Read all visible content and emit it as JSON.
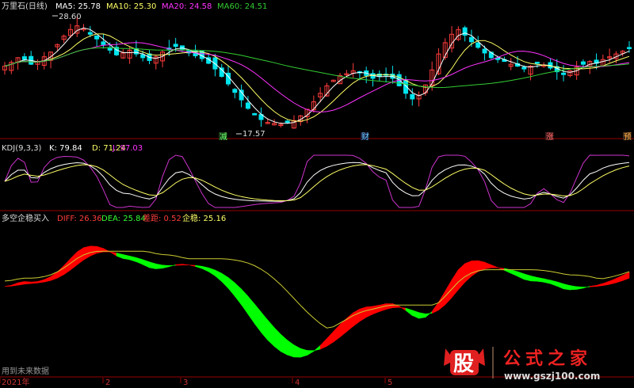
{
  "header": {
    "title": "万里石(日线)",
    "ma5": "MA5: 25.78",
    "ma10": "MA10: 25.30",
    "ma20": "MA20: 24.58",
    "ma60": "MA60: 24.51"
  },
  "price_notes": {
    "high": "28.60",
    "low": "17.57"
  },
  "signal_tags": [
    "减",
    "财",
    "涨",
    "预"
  ],
  "kdj_header": {
    "title": "KDJ(9,3,3)",
    "k": "K: 79.84",
    "d": "D: 71.24",
    "j": "J: 97.03"
  },
  "macd_header": {
    "title": "多空企稳买入",
    "diff": "DIFF: 26.36",
    "dea": "DEA: 25.84",
    "gap": "差距: 0.52",
    "stable": "企稳: 25.16"
  },
  "footer": {
    "note": "用到未来数据",
    "x_labels": [
      "2021年",
      "2",
      "3",
      "4",
      "5"
    ]
  },
  "watermark": {
    "logo_char": "股",
    "brand": "公式之家",
    "url": "www.gszj100.com"
  },
  "colors": {
    "up": "#ff3c3c",
    "down": "#00e5ee",
    "ma5": "#ffffff",
    "ma10": "#ffff66",
    "ma20": "#ff33ff",
    "ma60": "#33cc33",
    "diff_area_red": "#ff0000",
    "diff_area_green": "#00ff00",
    "axis": "#990000",
    "label_gold": "#d4b08a"
  },
  "chart_data": [
    {
      "type": "candlestick",
      "title": "万里石(日线)",
      "series_names": [
        "MA5",
        "MA10",
        "MA20",
        "MA60"
      ],
      "y_max_marked": 28.6,
      "y_min_marked": 17.57,
      "close_path": [
        23.9,
        24.3,
        24.8,
        24.6,
        24.1,
        24.4,
        24.9,
        25.4,
        26.2,
        27.1,
        27.8,
        28.2,
        27.9,
        27.3,
        26.8,
        26.2,
        25.6,
        25.1,
        25.3,
        25.6,
        25.2,
        24.8,
        24.5,
        24.9,
        25.4,
        25.8,
        26.0,
        25.7,
        25.3,
        25.0,
        24.7,
        24.2,
        23.6,
        22.8,
        22.0,
        21.1,
        20.3,
        19.4,
        18.7,
        18.2,
        17.9,
        17.8,
        17.7,
        17.9,
        18.1,
        18.6,
        19.3,
        20.1,
        21.0,
        21.8,
        22.4,
        22.9,
        23.1,
        23.4,
        23.2,
        22.9,
        22.6,
        22.8,
        23.0,
        22.6,
        21.8,
        21.0,
        20.4,
        20.8,
        21.9,
        23.5,
        25.2,
        26.4,
        27.3,
        27.8,
        27.2,
        26.5,
        25.9,
        25.3,
        24.8,
        24.6,
        24.4,
        24.1,
        23.9,
        23.6,
        23.9,
        24.2,
        24.0,
        23.7,
        23.3,
        23.0,
        23.4,
        23.8,
        24.1,
        24.4,
        24.2,
        24.6,
        24.9,
        25.2,
        25.5,
        25.8
      ]
    },
    {
      "type": "line",
      "title": "KDJ(9,3,3)",
      "series_names": [
        "K",
        "D",
        "J"
      ],
      "last_values": {
        "K": 79.84,
        "D": 71.24,
        "J": 97.03
      }
    },
    {
      "type": "area",
      "title": "多空企稳买入",
      "series_names": [
        "DIFF",
        "DEA",
        "差距",
        "企稳"
      ],
      "last_values": {
        "DIFF": 26.36,
        "DEA": 25.84,
        "差距": 0.52,
        "企稳": 25.16
      },
      "x_labels": [
        "2021年",
        "2",
        "3",
        "4",
        "5"
      ]
    }
  ]
}
